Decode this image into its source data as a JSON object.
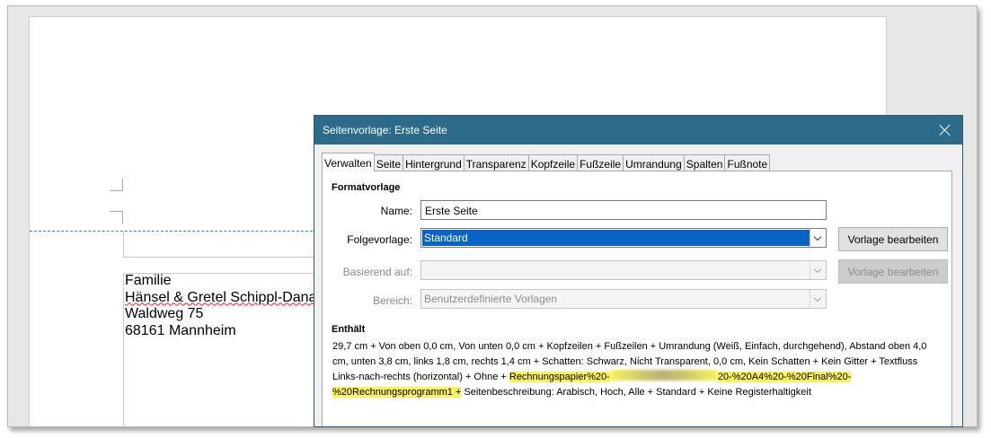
{
  "document": {
    "address_lines": [
      "Familie",
      "Hänsel & Gretel Schippl-Dana",
      "Waldweg 75",
      "68161 Mannheim"
    ]
  },
  "dialog": {
    "title": "Seitenvorlage: Erste Seite",
    "tabs": [
      "Verwalten",
      "Seite",
      "Hintergrund",
      "Transparenz",
      "Kopfzeile",
      "Fußzeile",
      "Umrandung",
      "Spalten",
      "Fußnote"
    ],
    "active_tab": "Verwalten",
    "section_formatvorlage": "Formatvorlage",
    "name": {
      "label": "Name:",
      "value": "Erste Seite"
    },
    "folgevorlage": {
      "label": "Folgevorlage:",
      "value": "Standard"
    },
    "basierend": {
      "label": "Basierend auf:",
      "value": ""
    },
    "bereich": {
      "label": "Bereich:",
      "value": "Benutzerdefinierte Vorlagen"
    },
    "btn_edit_1": "Vorlage bearbeiten",
    "btn_edit_2": "Vorlage bearbeiten",
    "section_enthaelt": "Enthält",
    "contains_text_1": "29,7 cm + Von oben 0,0 cm, Von unten 0,0 cm + Kopfzeilen + Fußzeilen + Umrandung (Weiß, Einfach, durchgehend), Abstand oben 4,0 cm, unten 3,8 cm, links 1,8 cm, rechts 1,4 cm + Schatten: Schwarz, Nicht Transparent, 0,0 cm, Kein Schatten + Kein Gitter + Textfluss Links-nach-rechts (horizontal) + Ohne + ",
    "contains_highlight_a": "Rechnungspapier%20-",
    "contains_highlight_b": "20-%20A4%20-%20Final%20-%20Rechnungsprogramm1 +",
    "contains_text_2": " Seitenbeschreibung: Arabisch, Hoch, Alle + Standard + Keine Registerhaltigkeit",
    "accent_color": "#2c6b8a",
    "selection_color": "#0a64c8",
    "highlight_color": "#fbf25a"
  }
}
